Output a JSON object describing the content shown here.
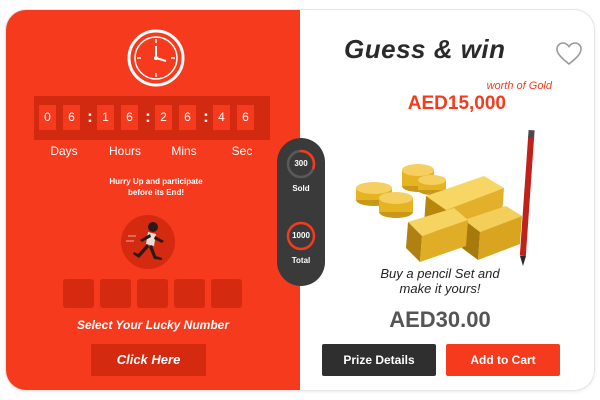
{
  "countdown": {
    "digits": [
      "0",
      "6",
      "1",
      "6",
      "2",
      "6",
      "4",
      "6"
    ],
    "labels": [
      "Days",
      "Hours",
      "Mins",
      "Sec"
    ]
  },
  "hurry_text": [
    "Hurry Up and participate",
    "before its End!"
  ],
  "lucky_number": {
    "boxes": [
      "",
      "",
      "",
      "",
      ""
    ],
    "label": "Select Your Lucky Number"
  },
  "click_here_label": "Click Here",
  "stats": {
    "sold_value": "300",
    "sold_label": "Sold",
    "total_value": "1000",
    "total_label": "Total",
    "sold_fraction": 0.3
  },
  "title": "Guess & win",
  "worth_label": "worth of Gold",
  "prize_amount": "AED15,000",
  "buy_text": [
    "Buy a pencil Set and",
    "make it yours!"
  ],
  "price": "AED30.00",
  "buttons": {
    "prize_details": "Prize Details",
    "add_to_cart": "Add to Cart"
  },
  "colors": {
    "brand_red": "#f63a1d",
    "dark_red": "#d42a10",
    "dark_gray": "#2f2f2f",
    "gold": "#e6b422"
  },
  "icons": [
    "clock-icon",
    "runner-icon",
    "heart-icon"
  ]
}
